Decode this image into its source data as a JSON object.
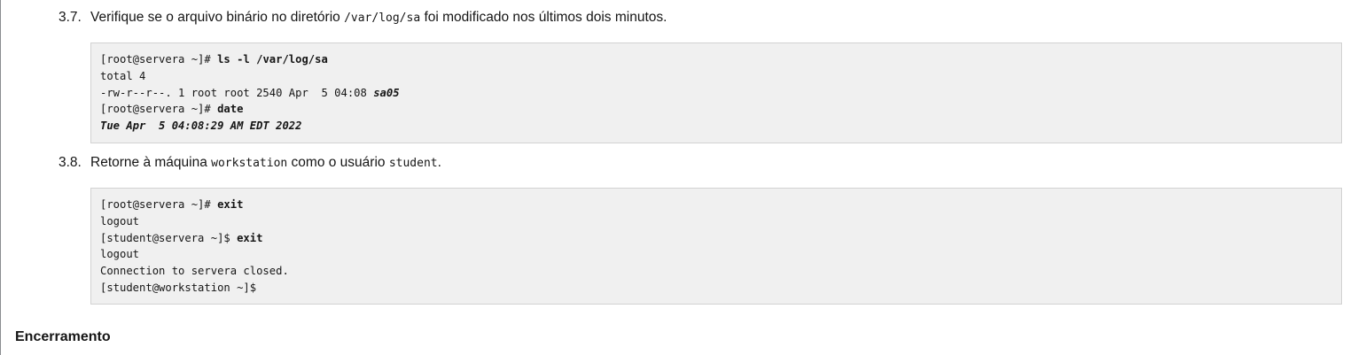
{
  "step_37": {
    "number": "3.7.",
    "text_before": "Verifique se o arquivo binário no diretório ",
    "path": "/var/log/sa",
    "text_after": " foi modificado nos últimos dois minutos."
  },
  "code_37": {
    "line1_prompt": "[root@servera ~]# ",
    "line1_cmd": "ls -l /var/log/sa",
    "line2": "total 4",
    "line3_prefix": "-rw-r--r--. 1 root root 2540 Apr  5 04:08 ",
    "line3_file": "sa05",
    "line4_prompt": "[root@servera ~]# ",
    "line4_cmd": "date",
    "line5": "Tue Apr  5 04:08:29 AM EDT 2022"
  },
  "step_38": {
    "number": "3.8.",
    "text_before": "Retorne à máquina ",
    "host": "workstation",
    "text_middle": " como o usuário ",
    "user": "student",
    "text_after": "."
  },
  "code_38": {
    "line1_prompt": "[root@servera ~]# ",
    "line1_cmd": "exit",
    "line2": "logout",
    "line3_prompt": "[student@servera ~]$ ",
    "line3_cmd": "exit",
    "line4": "logout",
    "line5": "Connection to servera closed.",
    "line6": "[student@workstation ~]$"
  },
  "section": {
    "heading": "Encerramento"
  }
}
